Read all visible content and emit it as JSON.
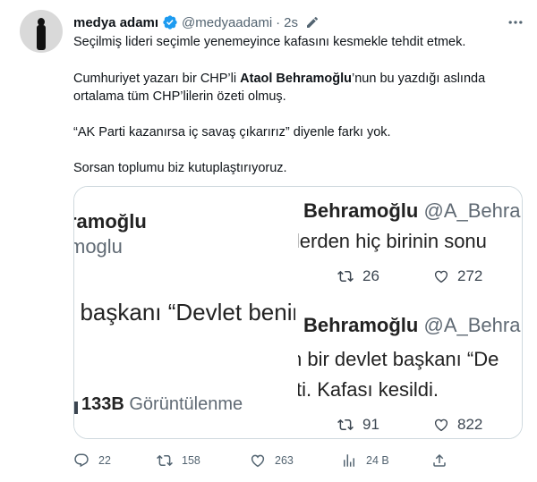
{
  "author": {
    "name": "medya adamı",
    "handle": "@medyaadami",
    "time": "2s"
  },
  "body": {
    "line1": "Seçilmiş lideri seçimle yenemeyince kafasını kesmekle tehdit etmek.",
    "line2_pre": "Cumhuriyet yazarı bir CHP’li ",
    "line2_bold": "Ataol Behramoğlu",
    "line2_post": "’nun bu yazdığı aslında",
    "line3": "ortalama tüm CHP’lilerin özeti olmuş.",
    "line4": "“AK Parti kazanırsa iç savaş çıkarırız” diyenle farkı yok.",
    "line5": "Sorsan toplumu biz kutuplaştırıyoruz."
  },
  "media": {
    "left": {
      "name": "ramoğlu",
      "handle": "moglu",
      "text": "t başkanı “Devlet benir",
      "views_count": "133B",
      "views_label": "Görüntülenme"
    },
    "right_top": {
      "name": "Behramoğlu",
      "handle": "@A_Behra",
      "text": "ilerden hiç birinin sonu",
      "retweets": "26",
      "likes": "272"
    },
    "right_bottom": {
      "name": "Behramoğlu",
      "handle": "@A_Behra",
      "text1": "n bir devlet başkanı “De",
      "text2": "ti. Kafası kesildi.",
      "retweets": "91",
      "likes": "822"
    }
  },
  "actions": {
    "replies": "22",
    "retweets": "158",
    "likes": "263",
    "views": "24 B"
  }
}
